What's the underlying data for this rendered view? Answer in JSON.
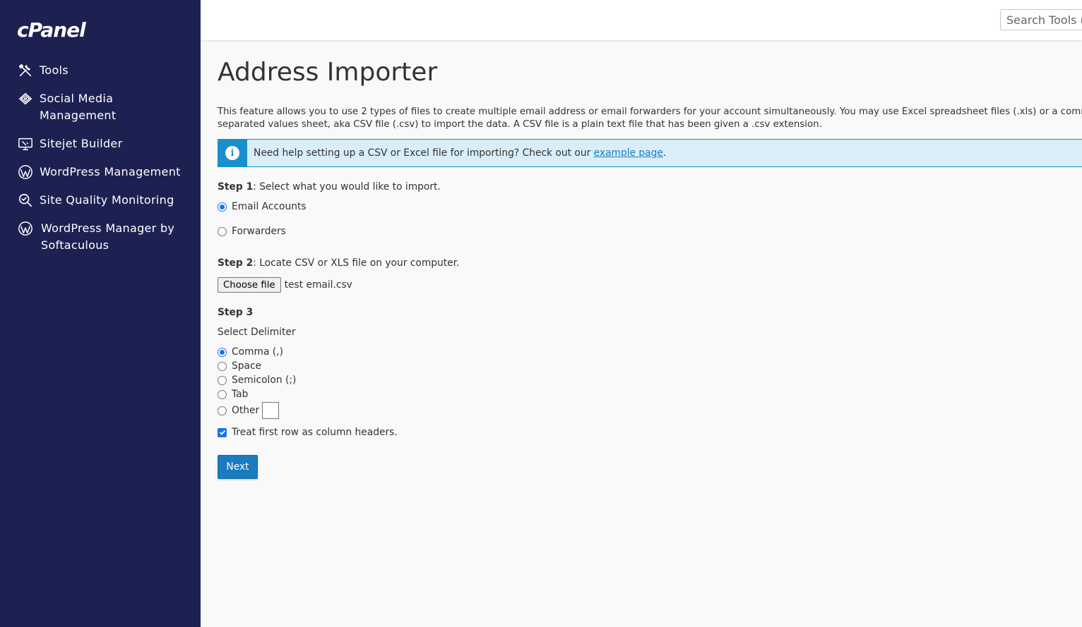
{
  "app": {
    "logo": "cPanel",
    "search_placeholder": "Search Tools (/)"
  },
  "sidebar": {
    "items": [
      {
        "label": "Tools",
        "icon": "tools-icon"
      },
      {
        "label": "Social Media Management",
        "icon": "social-media-icon"
      },
      {
        "label": "Sitejet Builder",
        "icon": "sitejet-icon"
      },
      {
        "label": "WordPress Management",
        "icon": "wordpress-icon"
      },
      {
        "label": "Site Quality Monitoring",
        "icon": "site-quality-icon"
      },
      {
        "label": "WordPress Manager by Softaculous",
        "icon": "wordpress-icon"
      }
    ]
  },
  "page": {
    "title": "Address Importer",
    "description": "This feature allows you to use 2 types of files to create multiple email address or email forwarders for your account simultaneously. You may use Excel spreadsheet files (.xls) or a comma-separated values sheet, aka CSV file (.csv) to import the data. A CSV file is a plain text file that has been given a .csv extension.",
    "alert": {
      "text": "Need help setting up a CSV or Excel file for importing? Check out our ",
      "link": "example page",
      "suffix": "."
    },
    "step1": {
      "label_bold": "Step 1",
      "label_rest": ": Select what you would like to import.",
      "options": [
        "Email Accounts",
        "Forwarders"
      ],
      "selected": "Email Accounts"
    },
    "step2": {
      "label_bold": "Step 2",
      "label_rest": ": Locate CSV or XLS file on your computer.",
      "choose_file_label": "Choose file",
      "file_name": "test email.csv"
    },
    "step3": {
      "label_bold": "Step 3",
      "select_delimiter": "Select Delimiter",
      "options": [
        "Comma (,)",
        "Space",
        "Semicolon (;)",
        "Tab",
        "Other"
      ],
      "selected": "Comma (,)",
      "header_checkbox": "Treat first row as column headers.",
      "header_checked": true
    },
    "next_label": "Next"
  },
  "colors": {
    "sidebar_bg": "#1d2152",
    "accent": "#1a7bbf",
    "alert_bg": "#d9eef8"
  }
}
